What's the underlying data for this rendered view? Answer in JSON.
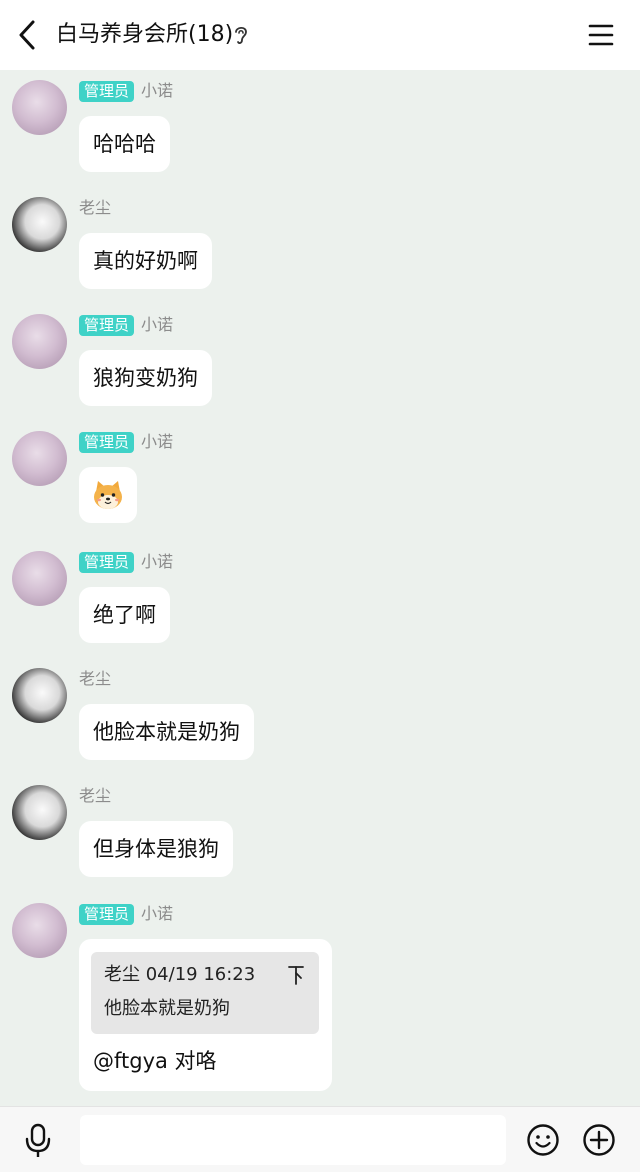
{
  "header": {
    "title": "白马养身会所(18)",
    "back_icon": "chevron-left-icon",
    "ear_icon": "ear-icon",
    "menu_icon": "hamburger-menu-icon"
  },
  "messages": [
    {
      "sender": "小诺",
      "role": "管理员",
      "text": "哈哈哈"
    },
    {
      "sender": "老尘",
      "text": "真的好奶啊"
    },
    {
      "sender": "小诺",
      "role": "管理员",
      "text": "狼狗变奶狗"
    },
    {
      "sender": "小诺",
      "role": "管理员",
      "sticker": "shiba-dog-emoji-icon"
    },
    {
      "sender": "小诺",
      "role": "管理员",
      "text": "绝了啊"
    },
    {
      "sender": "老尘",
      "text": "他脸本就是奶狗"
    },
    {
      "sender": "老尘",
      "text": "但身体是狼狗"
    },
    {
      "sender": "小诺",
      "role": "管理员",
      "reply": {
        "header": "老尘 04/19 16:23",
        "text": "他脸本就是奶狗"
      },
      "text": "@ftgya 对咯"
    }
  ],
  "input": {
    "placeholder": ""
  },
  "colors": {
    "background": "#ecf1ed",
    "admin_badge": "#3fd2c7",
    "nickname": "#8c8c8c"
  }
}
